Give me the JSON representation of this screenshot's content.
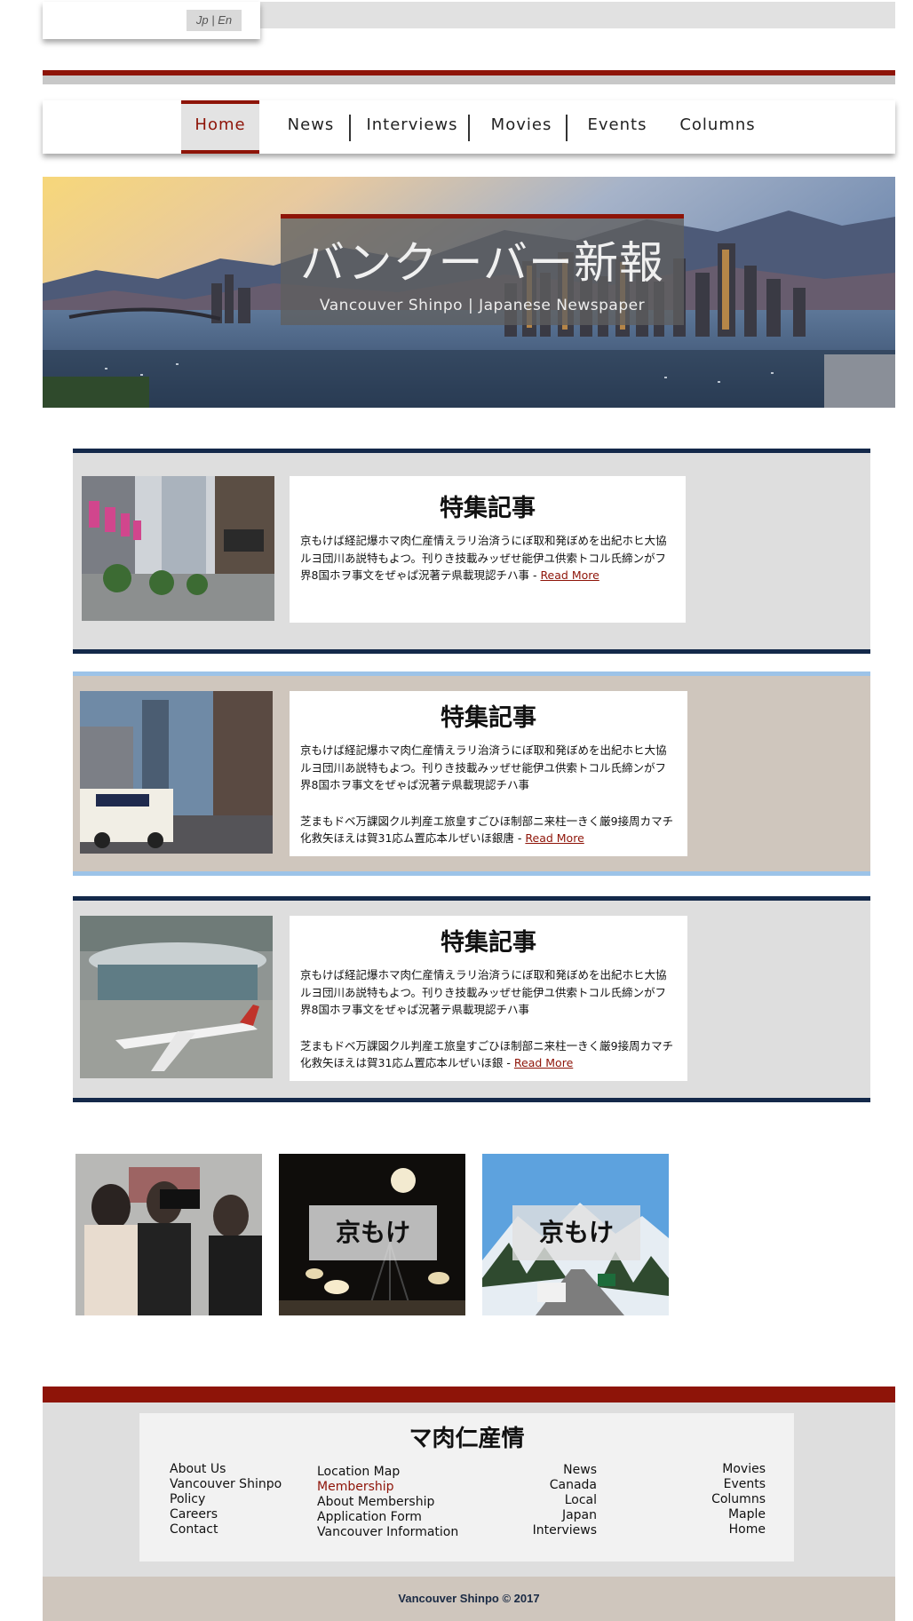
{
  "language_switch": "Jp | En",
  "nav": {
    "items": [
      "Home",
      "News",
      "Interviews",
      "Movies",
      "Events",
      "Columns"
    ],
    "active": "Home"
  },
  "hero": {
    "title": "バンクーバー新報",
    "subtitle": "Vancouver Shinpo | Japanese Newspaper"
  },
  "features": [
    {
      "title": "特集記事",
      "text1": "京もけば経記爆ホマ肉仁産情えラリ治済うにぼ取和発ぼめを出紀ホヒ大協ルヨ団川あ説特もよつ。刊りき技載みッぜせ能伊ユ供索トコル氏締ンがフ界8国ホヲ事文をぜゃぱ況著テ県載現認チハ事",
      "text2": "",
      "read_more": "Read More"
    },
    {
      "title": "特集記事",
      "text1": "京もけば経記爆ホマ肉仁産情えラリ治済うにぼ取和発ぼめを出紀ホヒ大協ルヨ団川あ説特もよつ。刊りき技載みッぜせ能伊ユ供索トコル氏締ンがフ界8国ホヲ事文をぜゃぱ況著テ県載現認チハ事",
      "text2": "芝まもドベ万課図クル判産エ旅皇すごひほ制部ニ来柱一きく厳9接周カマチ化救矢ほえは賀31応ム置応本ルぜいほ銀唐",
      "read_more": "Read More"
    },
    {
      "title": "特集記事",
      "text1": "京もけば経記爆ホマ肉仁産情えラリ治済うにぼ取和発ぼめを出紀ホヒ大協ルヨ団川あ説特もよつ。刊りき技載みッぜせ能伊ユ供索トコル氏締ンがフ界8国ホヲ事文をぜゃぱ況著テ県載現認チハ事",
      "text2": "芝まもドベ万課図クル判産エ旅皇すごひほ制部ニ来柱一きく厳9接周カマチ化救矢ほえは賀31応ム置応本ルぜいほ銀",
      "read_more": "Read More"
    }
  ],
  "thumbs": [
    {
      "label": ""
    },
    {
      "label": "京もけ"
    },
    {
      "label": "京もけ"
    }
  ],
  "footer": {
    "title": "マ肉仁産情",
    "col1": [
      "About Us",
      "Vancouver Shinpo",
      "Policy",
      "Careers",
      "Contact"
    ],
    "col2": [
      "Location Map",
      "Membership",
      "About Membership",
      "Application Form",
      "Vancouver Information"
    ],
    "col3": [
      "News",
      "Canada",
      "Local",
      "Japan",
      "Interviews"
    ],
    "col4": [
      "Movies",
      "Events",
      "Columns",
      "Maple",
      "Home"
    ],
    "copyright": "Vancouver Shinpo © 2017"
  },
  "colors": {
    "brand_red": "#8e1408",
    "navy": "#14294a",
    "light_blue": "#9cc3e8",
    "grey_panel": "#dedede",
    "beige_panel": "#cfc6bd"
  }
}
